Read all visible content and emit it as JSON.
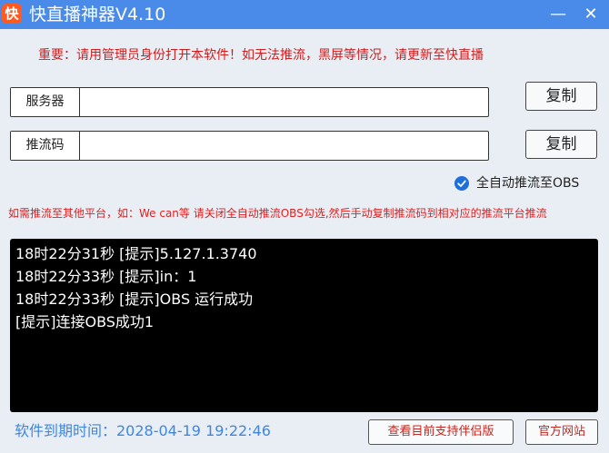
{
  "window": {
    "app_icon_glyph": "快",
    "title": "快直播神器V4.10",
    "minimize_glyph": "—",
    "close_glyph": "✕"
  },
  "notice": "重要：请用管理员身份打开本软件！如无法推流，黑屏等情况，请更新至快直播",
  "server": {
    "label": "服务器",
    "value": "",
    "copy_label": "复制"
  },
  "stream_key": {
    "label": "推流码",
    "value": "",
    "copy_label": "复制"
  },
  "auto_push": {
    "label": "全自动推流至OBS",
    "checked": true
  },
  "hint": "如需推流至其他平台，如：We can等  请关闭全自动推流OBS勾选,然后手动复制推流码到相对应的推流平台推流",
  "log": [
    "18时22分31秒 [提示]5.127.1.3740",
    "18时22分33秒 [提示]in：1",
    "18时22分33秒 [提示]OBS 运行成功",
    "[提示]连接OBS成功1"
  ],
  "footer": {
    "expiry_label": "软件到期时间：2028-04-19 19:22:46",
    "partners_button": "查看目前支持伴侣版",
    "website_button": "官方网站"
  },
  "colors": {
    "titlebar": "#4a8ae8",
    "notice_red": "#d11c1c",
    "expiry_blue": "#3e86e1",
    "check_blue": "#1e6fd9"
  }
}
